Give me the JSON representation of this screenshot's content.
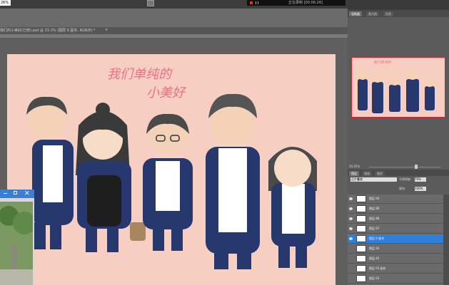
{
  "app": {
    "zoom_indicator": "26%",
    "recording_text": "正在录制 [00:06:28]",
    "document_tab": "我们的小美好(已修).psd @ 33.3% (图层 9 副本, RGB/8) *",
    "document_tab_close": "×"
  },
  "artwork": {
    "title_line1": "我们单纯的",
    "title_line2": "小美好"
  },
  "navigator": {
    "tabs": [
      "导航器",
      "直方图",
      "信息"
    ],
    "zoom_value": "26.65%"
  },
  "layers_panel": {
    "tabs": [
      "图层",
      "通道",
      "路径"
    ],
    "blend_mode": "正片叠底",
    "opacity_label": "不透明度:",
    "opacity_value": "79%",
    "fill_label": "填充:",
    "fill_value": "100%",
    "layers": [
      {
        "name": "图层 90",
        "visible": true,
        "selected": false
      },
      {
        "name": "图层 89",
        "visible": true,
        "selected": false
      },
      {
        "name": "图层 88",
        "visible": true,
        "selected": false
      },
      {
        "name": "图层 87",
        "visible": true,
        "selected": false
      },
      {
        "name": "图层 9 副本",
        "visible": true,
        "selected": true
      },
      {
        "name": "图层 94",
        "visible": false,
        "selected": false
      },
      {
        "name": "图层 92",
        "visible": false,
        "selected": false
      },
      {
        "name": "图层 93 副本",
        "visible": false,
        "selected": false
      },
      {
        "name": "图层 93",
        "visible": false,
        "selected": false
      }
    ]
  },
  "colors": {
    "canvas_bg": "#f7cfc2",
    "title_pink": "#ea6f86",
    "uniform_navy": "#27386e",
    "selection_blue": "#2f7fdb",
    "window_blue": "#3b7fd4"
  }
}
